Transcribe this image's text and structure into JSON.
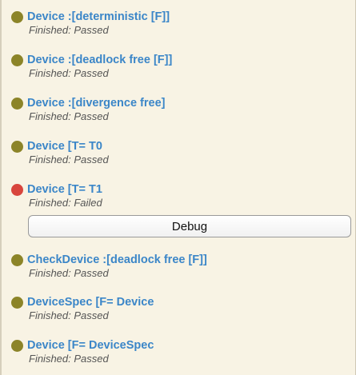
{
  "items": [
    {
      "title": "Device :[deterministic [F]]",
      "status": "Finished: Passed",
      "state_color": "#8c8428"
    },
    {
      "title": "Device :[deadlock free [F]]",
      "status": "Finished: Passed",
      "state_color": "#8c8428"
    },
    {
      "title": "Device :[divergence free]",
      "status": "Finished: Passed",
      "state_color": "#8c8428"
    },
    {
      "title": "Device [T= T0",
      "status": "Finished: Passed",
      "state_color": "#8c8428"
    },
    {
      "title": "Device [T= T1",
      "status": "Finished: Failed",
      "state_color": "#d8453d"
    },
    {
      "title": "CheckDevice :[deadlock free [F]]",
      "status": "Finished: Passed",
      "state_color": "#8c8428"
    },
    {
      "title": "DeviceSpec [F= Device",
      "status": "Finished: Passed",
      "state_color": "#8c8428"
    },
    {
      "title": "Device [F= DeviceSpec",
      "status": "Finished: Passed",
      "state_color": "#8c8428"
    }
  ],
  "debug_button": {
    "label": "Debug"
  }
}
